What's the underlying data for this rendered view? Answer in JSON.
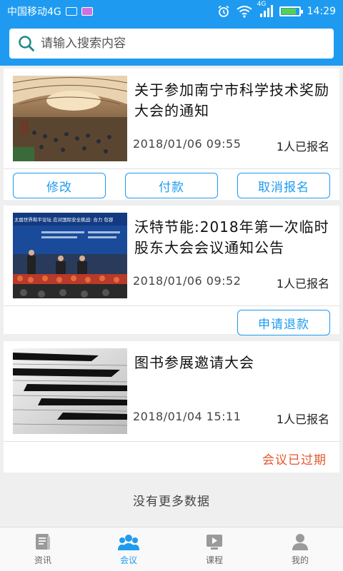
{
  "status_bar": {
    "carrier": "中国移动4G",
    "network": "4G",
    "time": "14:29",
    "battery_level": 0.85
  },
  "search": {
    "placeholder": "请输入搜索内容",
    "icon": "search-icon"
  },
  "meetings": [
    {
      "title": "关于参加南宁市科学技术奖励大会的通知",
      "datetime": "2018/01/06 09:55",
      "registered": "1人已报名",
      "actions": [
        "修改",
        "付款",
        "取消报名"
      ]
    },
    {
      "title": "沃特节能:2018年第一次临时股东大会会议通知公告",
      "datetime": "2018/01/06 09:52",
      "registered": "1人已报名",
      "banner_text": "太届世界和平论坛 应对国际安全挑战: 合力 包容",
      "actions": [
        "申请退款"
      ]
    },
    {
      "title": "图书参展邀请大会",
      "datetime": "2018/01/04 15:11",
      "registered": "1人已报名",
      "status": "会议已过期"
    }
  ],
  "footer_text": "没有更多数据",
  "tabs": [
    {
      "label": "资讯",
      "icon": "news-icon",
      "active": false
    },
    {
      "label": "会议",
      "icon": "meeting-icon",
      "active": true
    },
    {
      "label": "课程",
      "icon": "course-icon",
      "active": false
    },
    {
      "label": "我的",
      "icon": "profile-icon",
      "active": false
    }
  ],
  "colors": {
    "accent": "#1e9bf0",
    "expired": "#e4572e",
    "background": "#efefef"
  }
}
